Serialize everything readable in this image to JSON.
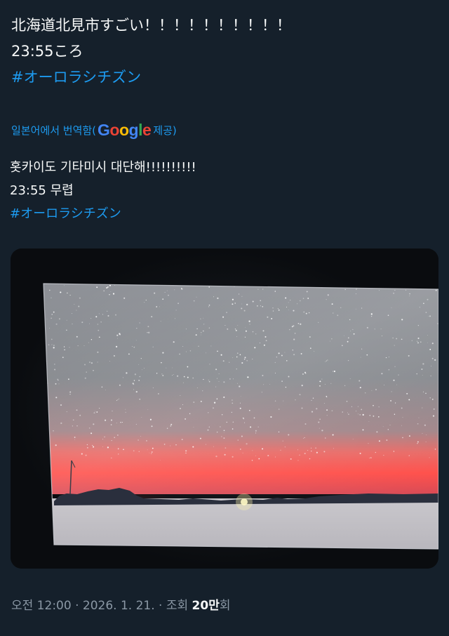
{
  "tweet": {
    "original_lines": [
      "北海道北見市すごい！！！！！！！！！！",
      "23:55ころ"
    ],
    "original_hashtag": "#オーロラシチズン",
    "translation": {
      "label_prefix": "일본어에서 번역함(",
      "google_letters": [
        "G",
        "o",
        "o",
        "g",
        "l",
        "e"
      ],
      "label_suffix": " 제공)"
    },
    "translated_lines": [
      "홋카이도 기타미시 대단해!!!!!!!!!!",
      "23:55 무렵"
    ],
    "translated_hashtag": "#オーロラシチズン"
  },
  "meta": {
    "time": "오전 12:00",
    "separator": " · ",
    "date": "2026. 1. 21.",
    "views_label": "조회",
    "views_count": "20만",
    "views_suffix": "회"
  },
  "colors": {
    "background": "#15202b",
    "text": "#f7f9f9",
    "link": "#1d9bf0",
    "secondary": "#8b98a5",
    "aurora_red": "#ff4b4b"
  }
}
